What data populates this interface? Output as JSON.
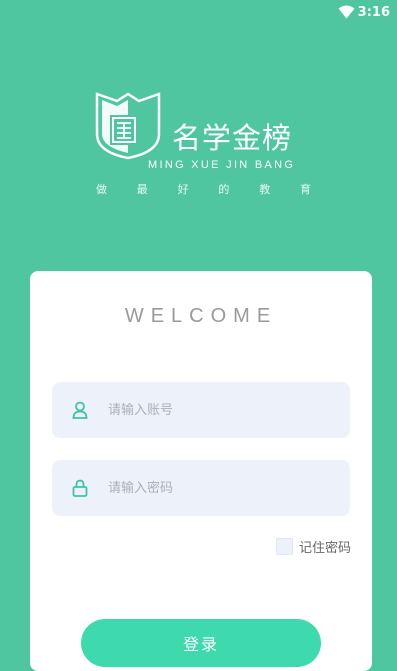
{
  "status_bar": {
    "time": "3:16",
    "wifi_icon": "wifi-icon"
  },
  "brand": {
    "name": "名学金榜",
    "pinyin": "MING XUE JIN BANG",
    "slogan": [
      "做",
      "最",
      "好",
      "的",
      "教",
      "育"
    ],
    "logo_icon": "shield-book-logo"
  },
  "login": {
    "welcome": "WELCOME",
    "account": {
      "placeholder": "请输入账号",
      "icon": "user-icon"
    },
    "password": {
      "placeholder": "请输入密码",
      "icon": "lock-icon"
    },
    "remember_label": "记住密码",
    "remember_checked": false,
    "submit_label": "登录"
  },
  "colors": {
    "background": "#4fc6a0",
    "card": "#ffffff",
    "field": "#edf2fa",
    "accent": "#3ed9ad",
    "icon": "#3ec59e"
  }
}
